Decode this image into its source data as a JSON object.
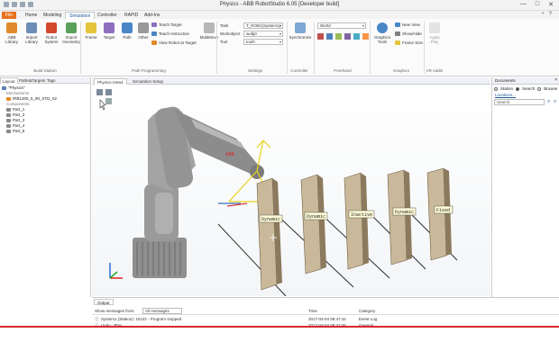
{
  "window": {
    "title": "Physics - ABB RobotStudio 6.05 [Developer build]",
    "controls": [
      "—",
      "□",
      "✕"
    ]
  },
  "ribbon_tabs": [
    "File",
    "Home",
    "Modeling",
    "Simulation",
    "Controller",
    "RAPID",
    "Add-Ins"
  ],
  "ribbon_tabs_active": "Simulation",
  "ribbon": {
    "buttons": [
      {
        "label": "ABB Library",
        "icon": "abb-library-icon"
      },
      {
        "label": "Import Library",
        "icon": "import-library-icon"
      },
      {
        "label": "Robot System",
        "icon": "robot-system-icon"
      },
      {
        "label": "Import Geometry",
        "icon": "import-geometry-icon"
      },
      {
        "label": "Frame",
        "icon": "frame-icon"
      },
      {
        "label": "Target",
        "icon": "target-icon"
      },
      {
        "label": "Path",
        "icon": "path-icon"
      },
      {
        "label": "Other",
        "icon": "other-icon"
      }
    ],
    "small_buttons": [
      "Teach Target",
      "Teach Instruction",
      "View Robot at Target"
    ],
    "multimove": "MultiMove",
    "settings": {
      "task_label": "Task",
      "task_value": "T_ROB1(System1)",
      "workobject_label": "Workobject",
      "workobject_value": "wobj0",
      "tool_label": "Tool",
      "tool_value": "tool0"
    },
    "freehand_combo": "World",
    "synchronize": "Synchronize",
    "graphics_tools": "Graphics Tools",
    "graphics_small": [
      "New View",
      "Show/Hide",
      "Frame Size"
    ],
    "apply_label": "Apply Play",
    "groups": [
      "Build Station",
      "Path Programming",
      "Settings",
      "Controller",
      "Freehand",
      "Graphics",
      "VR Addin"
    ]
  },
  "left_panel": {
    "tabs": [
      "Layout",
      "Paths&Targets",
      "Tags"
    ],
    "tree": [
      {
        "text": "\"Physics\"",
        "indent": 0
      },
      {
        "text": "Mechanisms",
        "indent": 1
      },
      {
        "text": "IRB1200_5_90_STD_02",
        "indent": 1
      },
      {
        "text": "Components",
        "indent": 1
      },
      {
        "text": "Part_1",
        "indent": 1
      },
      {
        "text": "Part_2",
        "indent": 1
      },
      {
        "text": "Part_3",
        "indent": 1
      },
      {
        "text": "Part_4",
        "indent": 1
      },
      {
        "text": "Part_5",
        "indent": 1
      }
    ]
  },
  "doc_tabs": [
    "Physics:View1",
    "Simulation Setup"
  ],
  "viewport": {
    "labels": [
      "Dynamic",
      "Dynamic",
      "Inactive",
      "Dynamic",
      "Fixed"
    ],
    "robot_logo": "ABB"
  },
  "right_panel": {
    "title": "Documents",
    "radio_browse": "Browse",
    "radio_search": "Search",
    "radio_station": "Station",
    "locations": "Locations...",
    "search_placeholder": "Search"
  },
  "output": {
    "tab": "Output",
    "show_messages_label": "Show messages from:",
    "show_messages_value": "All messages",
    "columns": [
      "Time",
      "Category"
    ],
    "rows": [
      {
        "message": "System1 (Station): 10122 - Program stopped",
        "time": "2017-04-04 08:47:44",
        "category": "Event Log"
      },
      {
        "message": "Undo : Play",
        "time": "2017-04-04 08:47:46",
        "category": "General"
      }
    ]
  },
  "colors": {
    "file_tab": "#e8721c",
    "accent_blue": "#1c5a9e",
    "robot_body": "#8f8f8f",
    "block_face": "#c9b99a",
    "label_yellow": "#fffbd6",
    "target_yellow": "#e9d21a"
  }
}
